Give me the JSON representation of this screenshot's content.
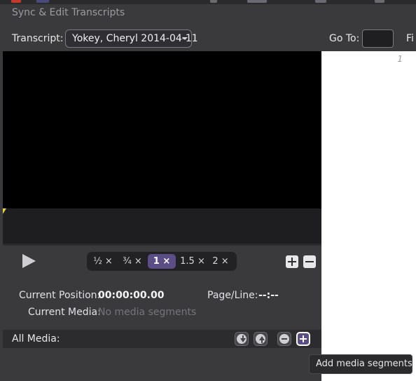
{
  "window": {
    "title": "Sync & Edit Transcripts"
  },
  "controls": {
    "transcript_label": "Transcript:",
    "transcript_value": "Yokey, Cheryl 2014-04-11",
    "goto_label": "Go To:",
    "goto_value": "",
    "find_label_partial": "Fi"
  },
  "transcript_pane": {
    "line_number": "1"
  },
  "player": {
    "speeds": [
      "½ ×",
      "¾ ×",
      "1 ×",
      "1.5 ×",
      "2 ×"
    ],
    "active_speed": "1 ×"
  },
  "info": {
    "current_position_label": "Current Position:",
    "current_position_value": "00:00:00.00",
    "page_line_label": "Page/Line:",
    "page_line_value": "--:--",
    "current_media_label": "Current Media:",
    "current_media_value": "No media segments"
  },
  "media_bar": {
    "label": "All Media:"
  },
  "tooltip": {
    "text": "Add media segments"
  },
  "colors": {
    "accent": "#5b4e86",
    "background": "#3a3a3d",
    "playhead": "#e8d23a"
  }
}
